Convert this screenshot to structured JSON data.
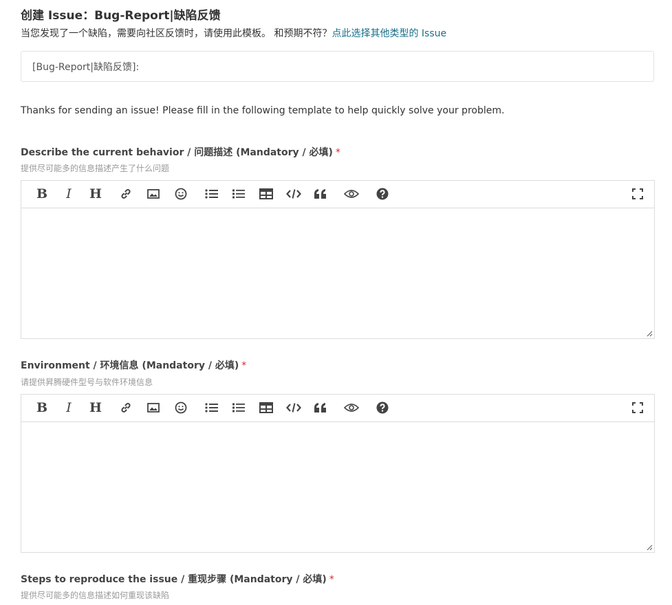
{
  "header": {
    "title": "创建 Issue：Bug-Report|缺陷反馈",
    "subtitle_text": "当您发现了一个缺陷，需要向社区反馈时，请使用此模板。 和预期不符？",
    "subtitle_link": "点此选择其他类型的 Issue"
  },
  "title_input": {
    "value": "[Bug-Report|缺陷反馈]:"
  },
  "intro_text": "Thanks for sending an issue! Please fill in the following template to help quickly solve your problem.",
  "fields": [
    {
      "label": "Describe the current behavior / 问题描述 (Mandatory / 必填)",
      "required_mark": "*",
      "help": "提供尽可能多的信息描述产生了什么问题"
    },
    {
      "label": "Environment / 环境信息 (Mandatory / 必填)",
      "required_mark": "*",
      "help": "请提供昇腾硬件型号与软件环境信息"
    },
    {
      "label": "Steps to reproduce the issue / 重现步骤 (Mandatory / 必填)",
      "required_mark": "*",
      "help": "提供尽可能多的信息描述如何重现该缺陷"
    }
  ],
  "toolbar": {
    "bold_glyph": "B",
    "italic_glyph": "I",
    "heading_glyph": "H",
    "icons": [
      "bold-icon",
      "italic-icon",
      "heading-icon",
      "link-icon",
      "image-icon",
      "emoji-icon",
      "unordered-list-icon",
      "ordered-list-icon",
      "table-icon",
      "code-icon",
      "quote-icon",
      "preview-icon",
      "help-icon",
      "fullscreen-icon"
    ]
  },
  "colors": {
    "link": "#1a6f8a",
    "required": "#db2828",
    "border": "#dcdcdc",
    "help_text": "#999999"
  }
}
